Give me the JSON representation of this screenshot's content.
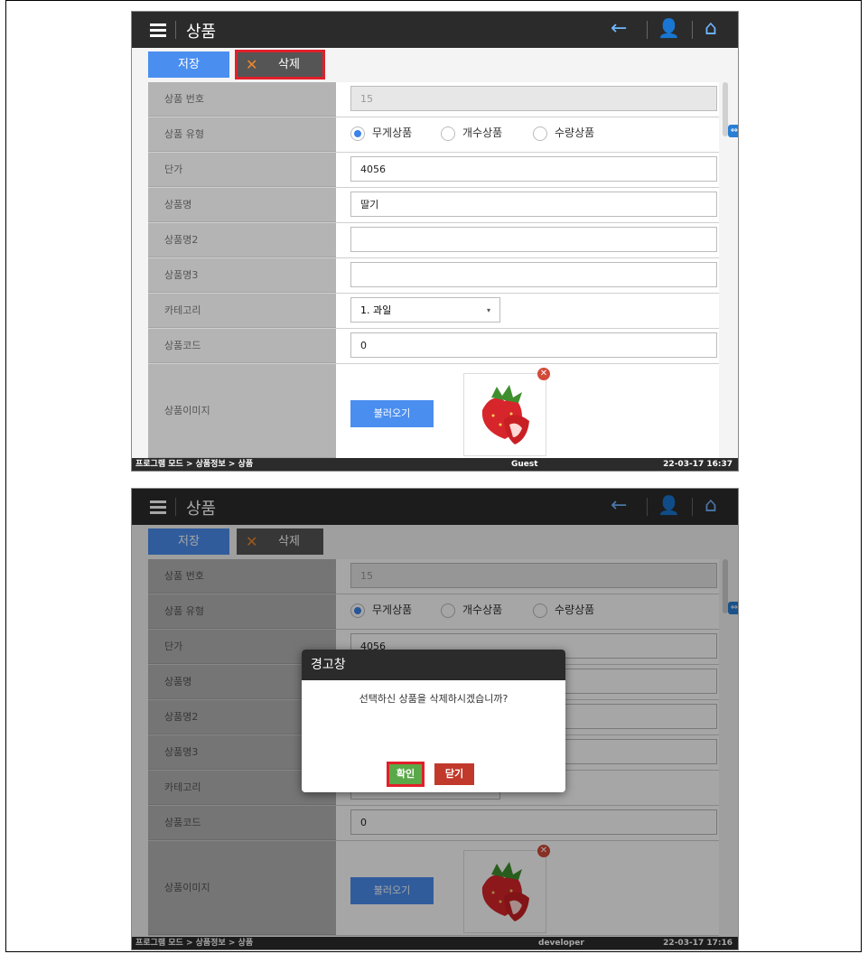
{
  "colors": {
    "topbar": "#2b2b2b",
    "accent": "#4a8ef0",
    "delete_x": "#f0892f",
    "highlight": "#e0202a",
    "ok": "#5aa948",
    "close": "#c0392b"
  },
  "shots": [
    {
      "title": "상품",
      "toolbar": {
        "save_label": "저장",
        "delete_label": "삭제"
      },
      "labels": {
        "product_no": "상품 번호",
        "product_type": "상품 유형",
        "unit_price": "단가",
        "product_name": "상품명",
        "product_name2": "상품명2",
        "product_name3": "상품명3",
        "category": "카테고리",
        "product_code": "상품코드",
        "product_image": "상품이미지"
      },
      "values": {
        "product_no": "15",
        "unit_price": "4056",
        "product_name": "딸기",
        "product_name2": "",
        "product_name3": "",
        "category": "1. 과일",
        "product_code": "0"
      },
      "radio": {
        "opt1": "무게상품",
        "opt2": "개수상품",
        "opt3": "수량상품",
        "selected": "무게상품"
      },
      "load_label": "불러오기",
      "status": {
        "path": "프로그램 모드 > 상품정보 > 상품",
        "user": "Guest",
        "time": "22-03-17 16:37"
      }
    },
    {
      "title": "상품",
      "toolbar": {
        "save_label": "저장",
        "delete_label": "삭제"
      },
      "labels": {
        "product_no": "상품 번호",
        "product_type": "상품 유형",
        "unit_price": "단가",
        "product_name": "상품명",
        "product_name2": "상품명2",
        "product_name3": "상품명3",
        "category": "카테고리",
        "product_code": "상품코드",
        "product_image": "상품이미지"
      },
      "values": {
        "product_no": "15",
        "unit_price": "4056",
        "product_code": "0"
      },
      "radio": {
        "opt1": "무게상품",
        "opt2": "개수상품",
        "opt3": "수량상품",
        "selected": "무게상품"
      },
      "load_label": "불러오기",
      "dialog": {
        "title": "경고창",
        "message": "선택하신 상품을 삭제하시겠습니까?",
        "ok": "확인",
        "close": "닫기"
      },
      "status": {
        "path": "프로그램 모드 > 상품정보 > 상품",
        "user": "developer",
        "time": "22-03-17 17:16"
      }
    }
  ]
}
